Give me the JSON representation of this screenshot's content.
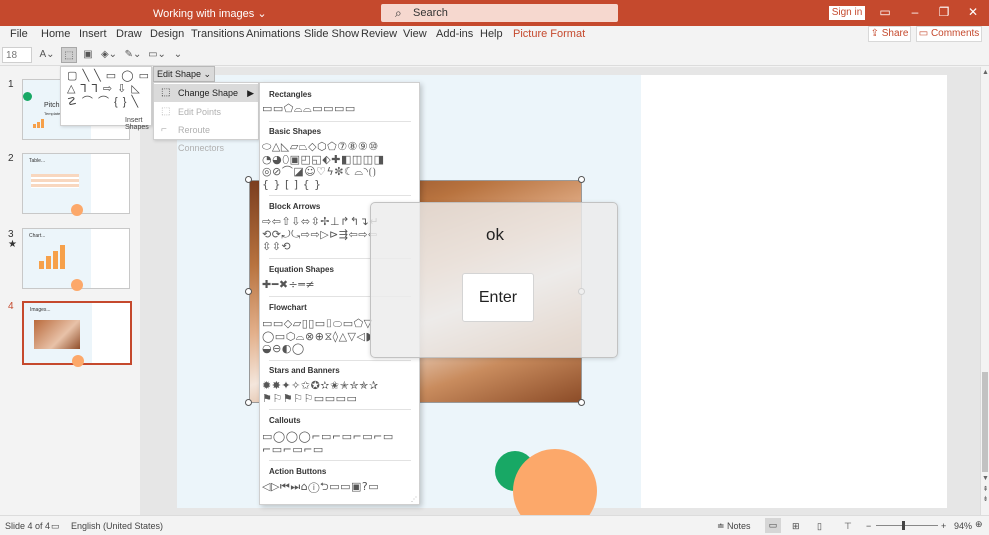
{
  "titlebar": {
    "doc_title": "Working with images  ⌄",
    "search_placeholder": "Search",
    "signin_label": "Sign in",
    "ribbon_display_icon": "ribbon-display-icon",
    "minimize": "–",
    "restore": "❐",
    "close": "✕"
  },
  "menu": {
    "items": [
      "File",
      "Home",
      "Insert",
      "Draw",
      "Design",
      "Transitions",
      "Animations",
      "Slide Show",
      "Review",
      "View",
      "Add-ins",
      "Help",
      "Picture Format"
    ],
    "share_label": "Share",
    "comments_label": "Comments"
  },
  "ribbon": {
    "font_size": "18"
  },
  "insert_shapes": {
    "label": "Insert Shapes",
    "glyph_rows": [
      "▢ ╲ ╲ ▭ ◯ ▭",
      "△ ⅂ ⅂ ⇨ ⇩ ◺",
      "☡ ⌒ ⌒ { } ╲"
    ]
  },
  "edit_shape": {
    "button_label": "Edit Shape ⌄",
    "items": [
      {
        "label": "Change Shape",
        "state": "active"
      },
      {
        "label": "Edit Points",
        "state": "disabled"
      },
      {
        "label": "Reroute Connectors",
        "state": "disabled"
      }
    ]
  },
  "shape_gallery": {
    "sections": [
      {
        "title": "Rectangles",
        "glyphs": "▭▭⬠⌓⌓▭▭▭▭"
      },
      {
        "title": "Basic Shapes",
        "glyphs": "⬭△◺▱⏢◇⬡⬠⑦⑧⑨⑩\n◔◕⬯▣◰◱⬖✚◧◫◫◨\n◎⊘⌒◪☺♡ϟ✼☾⌓◝⟮⟯\n{ } [ ] { }"
      },
      {
        "title": "Block Arrows",
        "glyphs": "⇨⇦⇧⇩⬄⇳✢⊥↱↰↴↵\n⟲⟳⤾⤿⇨⇨▷⊳⇶⇦⇨⇦\n⇳⇳⟲"
      },
      {
        "title": "Equation Shapes",
        "glyphs": "✚━✖÷═≠"
      },
      {
        "title": "Flowchart",
        "glyphs": "▭▭◇▱▯▯▭⌷⬭▭⬠▽\n◯▭⬡⌓⊗⊕⧖◊△▽◁◗\n◒⊖◐◯"
      },
      {
        "title": "Stars and Banners",
        "glyphs": "✹✸✦✧✩✪✫✬✭✮✯✰\n⚑⚐⚑⚐⚐▭▭▭▭"
      },
      {
        "title": "Callouts",
        "glyphs": "▭◯◯◯⌐▭⌐▭⌐▭⌐▭\n⌐▭⌐▭⌐▭"
      },
      {
        "title": "Action Buttons",
        "glyphs": "◁▷⏮⏭⌂ⓘ⮌▭▭▣?▭"
      }
    ]
  },
  "thumbnails": [
    {
      "number": "1",
      "label": "Pitch D...",
      "sublabel": "Template",
      "marker": ""
    },
    {
      "number": "2",
      "label": "Table...",
      "sublabel": "",
      "marker": ""
    },
    {
      "number": "3",
      "label": "Chart...",
      "sublabel": "",
      "marker": "★"
    },
    {
      "number": "4",
      "label": "Images...",
      "sublabel": "",
      "marker": ""
    }
  ],
  "osk": {
    "typed_text": "ok",
    "enter_label": "Enter"
  },
  "statusbar": {
    "slide_info": "Slide 4 of 4",
    "language": "English (United States)",
    "notes_label": "Notes",
    "zoom_minus": "−",
    "zoom_plus": "+",
    "zoom_level": "94%"
  },
  "colors": {
    "accent": "#c5492d",
    "slide_bg": "#ecf5fa",
    "green_circle": "#18a865",
    "orange_circle": "#fca86a"
  }
}
